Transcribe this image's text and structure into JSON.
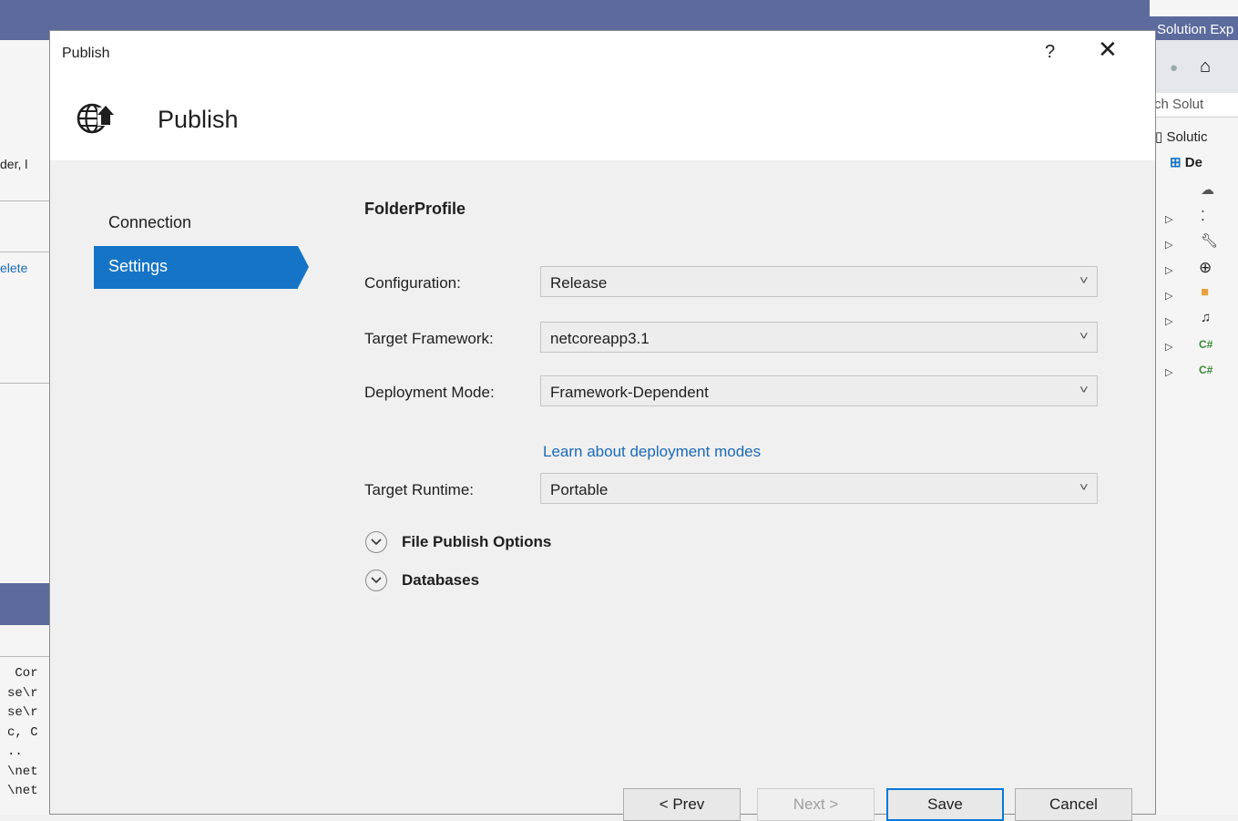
{
  "background": {
    "left_fragments": [
      "der, l",
      "elete"
    ],
    "left_code_lines": [
      " Cor",
      "se\\r",
      "se\\r",
      "c, C",
      "..",
      "\\net",
      "\\net"
    ],
    "solution_explorer": {
      "title": "Solution Exp",
      "search_placeholder": "rch Solut",
      "solution_label": "Solutic",
      "project_label": "De",
      "tree_icons": [
        "cloud-icon",
        "dependencies-icon",
        "wrench-icon",
        "globe-icon",
        "folder-icon",
        "branch-icon",
        "csharp-icon",
        "csharp-icon"
      ],
      "csharp_label": "C#"
    }
  },
  "dialog": {
    "title": "Publish",
    "help": "?",
    "close": "✕",
    "header_title": "Publish",
    "nav": [
      {
        "label": "Connection",
        "selected": false
      },
      {
        "label": "Settings",
        "selected": true
      }
    ],
    "profile_name": "FolderProfile",
    "fields": {
      "configuration": {
        "label": "Configuration:",
        "value": "Release"
      },
      "target_framework": {
        "label": "Target Framework:",
        "value": "netcoreapp3.1"
      },
      "deployment_mode": {
        "label": "Deployment Mode:",
        "value": "Framework-Dependent"
      },
      "target_runtime": {
        "label": "Target Runtime:",
        "value": "Portable"
      }
    },
    "deployment_link": "Learn about deployment modes",
    "expanders": [
      "File Publish Options",
      "Databases"
    ],
    "buttons": {
      "prev": "< Prev",
      "next": "Next >",
      "save": "Save",
      "cancel": "Cancel"
    },
    "colors": {
      "accent": "#1574c5",
      "link": "#1a6bb8",
      "chrome": "#5c6b9c"
    }
  }
}
